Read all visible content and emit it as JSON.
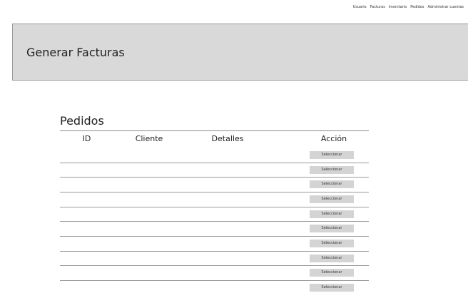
{
  "nav": {
    "items": [
      "Usuario",
      "Facturas",
      "Inventario",
      "Pedidos",
      "Administrar cuentas"
    ]
  },
  "banner": {
    "title": "Generar Facturas"
  },
  "orders": {
    "title": "Pedidos",
    "columns": {
      "id": "ID",
      "cliente": "Cliente",
      "detalles": "Detalles",
      "accion": "Acción"
    },
    "rows": [
      {
        "action_label": "Seleccionar"
      },
      {
        "action_label": "Seleccionar"
      },
      {
        "action_label": "Seleccionar"
      },
      {
        "action_label": "Seleccionar"
      },
      {
        "action_label": "Seleccionar"
      },
      {
        "action_label": "Seleccionar"
      },
      {
        "action_label": "Seleccionar"
      },
      {
        "action_label": "Seleccionar"
      },
      {
        "action_label": "Seleccionar"
      },
      {
        "action_label": "Seleccionar"
      }
    ]
  }
}
